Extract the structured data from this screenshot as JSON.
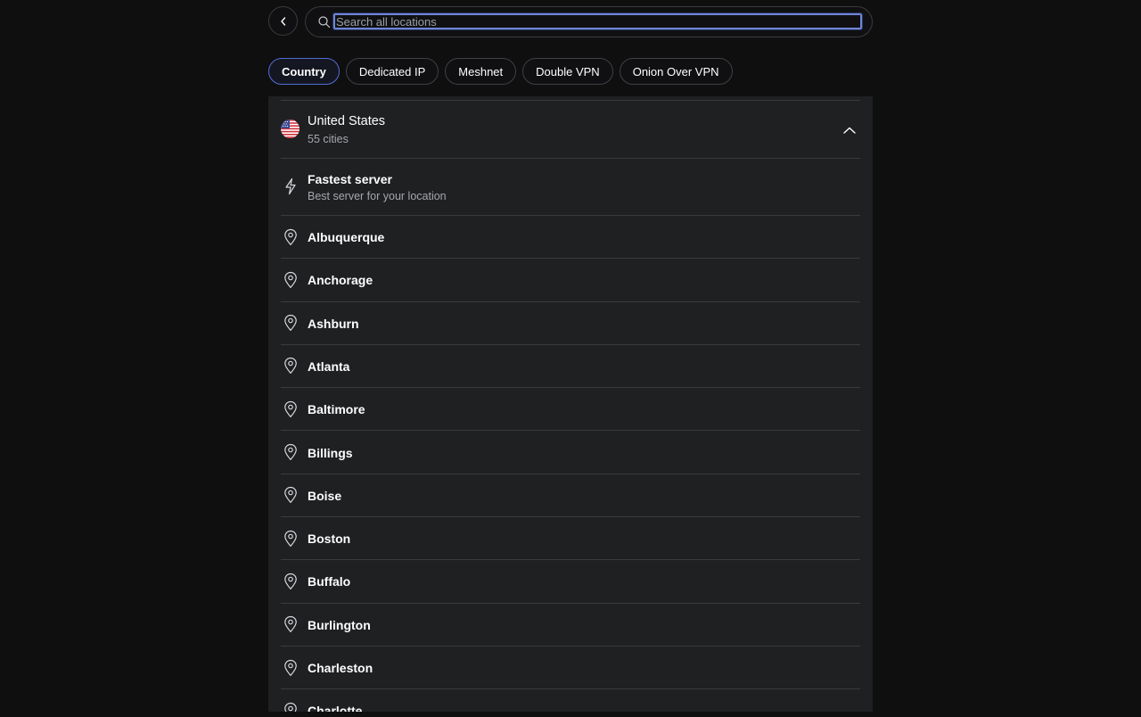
{
  "search": {
    "placeholder": "Search all locations"
  },
  "tabs": [
    {
      "label": "Country",
      "active": true
    },
    {
      "label": "Dedicated IP",
      "active": false
    },
    {
      "label": "Meshnet",
      "active": false
    },
    {
      "label": "Double VPN",
      "active": false
    },
    {
      "label": "Onion Over VPN",
      "active": false
    }
  ],
  "country": {
    "name": "United States",
    "subtitle": "55 cities",
    "icon": "us-flag-icon",
    "expanded": true
  },
  "fastest": {
    "title": "Fastest server",
    "subtitle": "Best server for your location",
    "icon": "lightning-icon"
  },
  "cities": [
    "Albuquerque",
    "Anchorage",
    "Ashburn",
    "Atlanta",
    "Baltimore",
    "Billings",
    "Boise",
    "Boston",
    "Buffalo",
    "Burlington",
    "Charleston",
    "Charlotte"
  ],
  "colors": {
    "background": "#0f0f10",
    "panel": "#1f2022",
    "accent": "#4f6fd4",
    "divider": "#3a3b3e"
  }
}
